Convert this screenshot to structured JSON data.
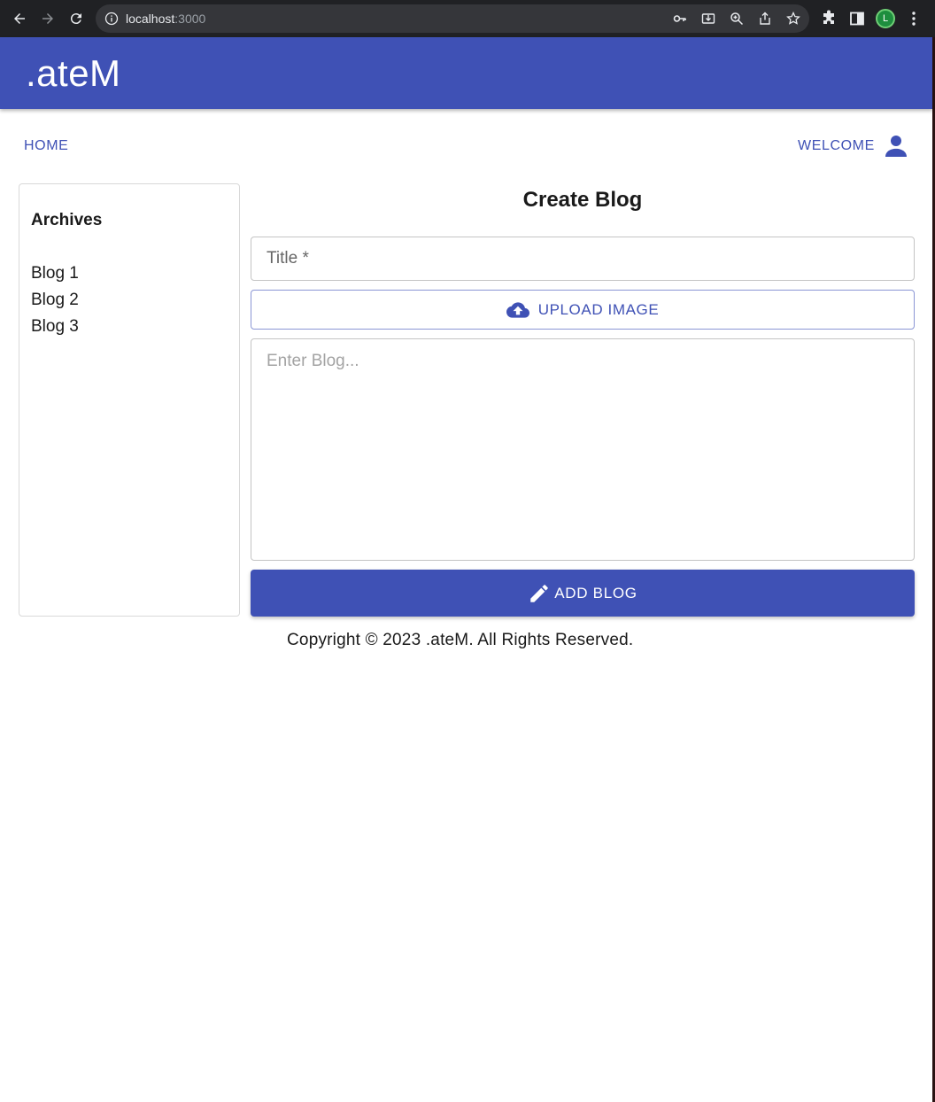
{
  "browser": {
    "url_host": "localhost",
    "url_port": ":3000",
    "profile_initial": "L"
  },
  "app": {
    "brand": ".ateM",
    "colors": {
      "primary": "#3f51b5"
    }
  },
  "nav": {
    "home_label": "HOME",
    "welcome_label": "WELCOME"
  },
  "archives": {
    "heading": "Archives",
    "items": [
      "Blog 1",
      "Blog 2",
      "Blog 3"
    ]
  },
  "form": {
    "title": "Create Blog",
    "title_placeholder": "Title *",
    "upload_label": "UPLOAD IMAGE",
    "body_placeholder": "Enter Blog...",
    "submit_label": "ADD BLOG"
  },
  "footer": {
    "copyright": "Copyright © 2023 .ateM. All Rights Reserved."
  },
  "icons": {
    "back": "back-arrow-icon",
    "forward": "forward-arrow-icon",
    "reload": "reload-icon",
    "info": "info-icon",
    "key": "key-icon",
    "install": "install-icon",
    "zoom": "zoom-icon",
    "share": "share-icon",
    "bookmark": "star-icon",
    "extensions": "puzzle-icon",
    "sidepanel": "side-panel-icon",
    "menu": "kebab-menu-icon",
    "user": "user-icon",
    "upload": "cloud-upload-icon",
    "edit": "pencil-icon"
  }
}
